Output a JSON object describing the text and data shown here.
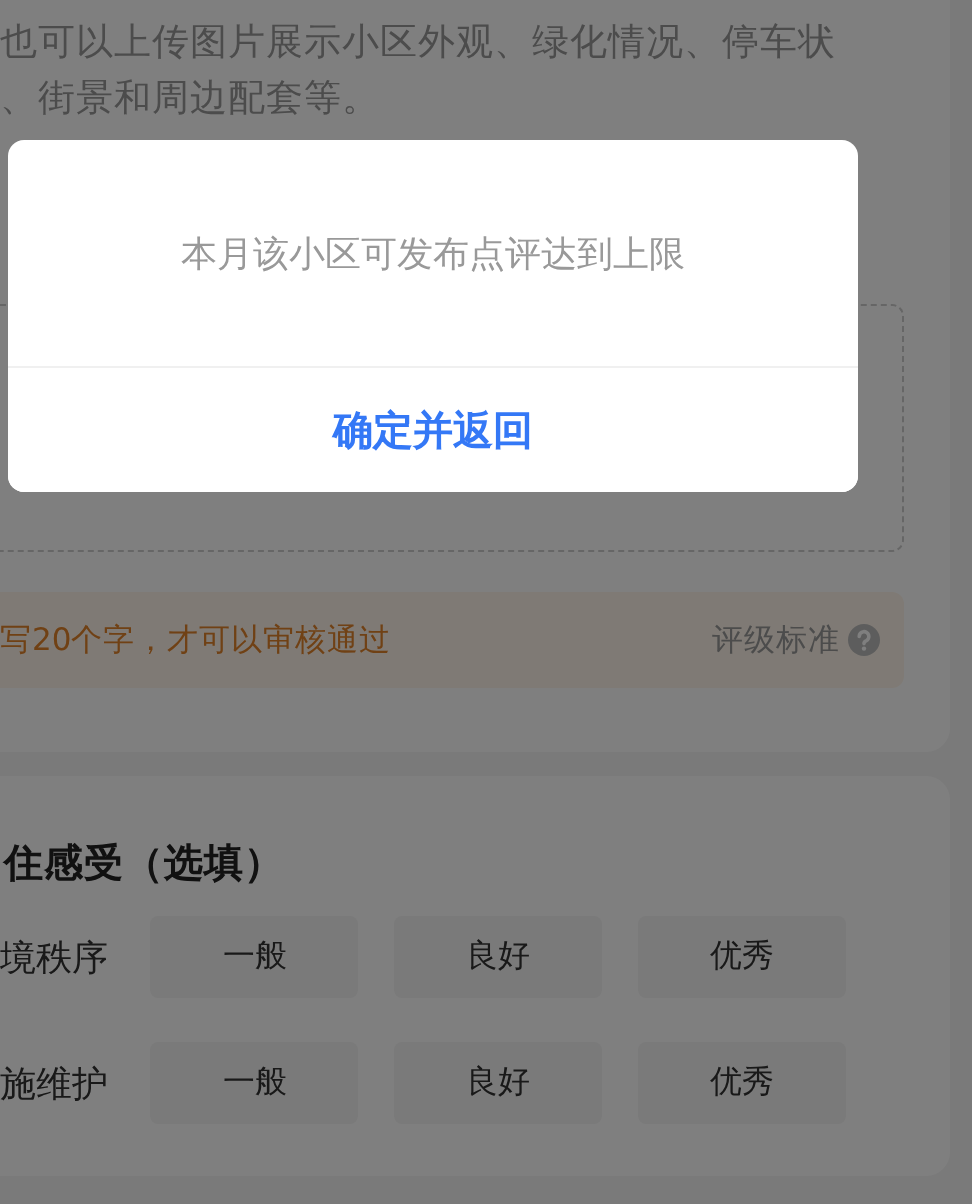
{
  "intro": {
    "lines": [
      "也可以上传图片展示小区外观、绿化情况、停车状",
      "、街景和周边配套等。"
    ]
  },
  "tip": {
    "text": "写20个字，才可以审核通过",
    "link": "评级标准"
  },
  "experience": {
    "title": "住感受（选填）",
    "rows": [
      {
        "label": "境秩序",
        "options": [
          {
            "label": "一般",
            "selected": false
          },
          {
            "label": "良好",
            "selected": false
          },
          {
            "label": "优秀",
            "selected": false
          }
        ]
      },
      {
        "label": "施维护",
        "options": [
          {
            "label": "一般",
            "selected": false
          },
          {
            "label": "良好",
            "selected": false
          },
          {
            "label": "优秀",
            "selected": false
          }
        ]
      }
    ]
  },
  "dialog": {
    "message": "本月该小区可发布点评达到上限",
    "button": "确定并返回"
  }
}
